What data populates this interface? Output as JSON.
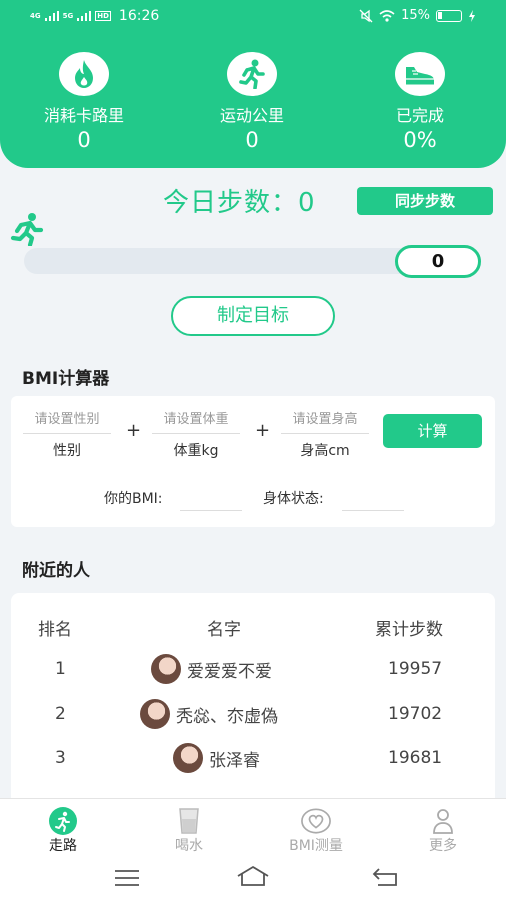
{
  "status": {
    "network1": "4G",
    "network2": "5G",
    "hd": "HD",
    "time": "16:26",
    "battery": "15%"
  },
  "stats": [
    {
      "icon": "fire-icon",
      "label": "消耗卡路里",
      "value": "0"
    },
    {
      "icon": "runner-icon",
      "label": "运动公里",
      "value": "0"
    },
    {
      "icon": "shoe-icon",
      "label": "已完成",
      "value": "0%"
    }
  ],
  "steps": {
    "title": "今日步数：",
    "count": "0",
    "sync_label": "同步步数",
    "progress_value": "0",
    "progress_fraction": 0
  },
  "goal_label": "制定目标",
  "bmi": {
    "title": "BMI计算器",
    "gender_placeholder": "请设置性别",
    "gender_label": "性别",
    "weight_placeholder": "请设置体重",
    "weight_label": "体重kg",
    "height_placeholder": "请设置身高",
    "height_label": "身高cm",
    "plus": "+",
    "calc_label": "计算",
    "result_label": "你的BMI:",
    "status_label": "身体状态:"
  },
  "nearby": {
    "title": "附近的人",
    "headers": [
      "排名",
      "名字",
      "累计步数"
    ],
    "rows": [
      {
        "rank": "1",
        "name": "爱爱爱不爱",
        "steps": "19957"
      },
      {
        "rank": "2",
        "name": "秃惢、夵虚偽",
        "steps": "19702"
      },
      {
        "rank": "3",
        "name": "张泽睿",
        "steps": "19681"
      }
    ]
  },
  "tabs": [
    {
      "label": "走路",
      "icon": "walk-icon",
      "active": true
    },
    {
      "label": "喝水",
      "icon": "cup-icon",
      "active": false
    },
    {
      "label": "BMI测量",
      "icon": "heart-icon",
      "active": false
    },
    {
      "label": "更多",
      "icon": "person-icon",
      "active": false
    }
  ],
  "colors": {
    "accent": "#22c98a",
    "background": "#f1f4f7"
  }
}
